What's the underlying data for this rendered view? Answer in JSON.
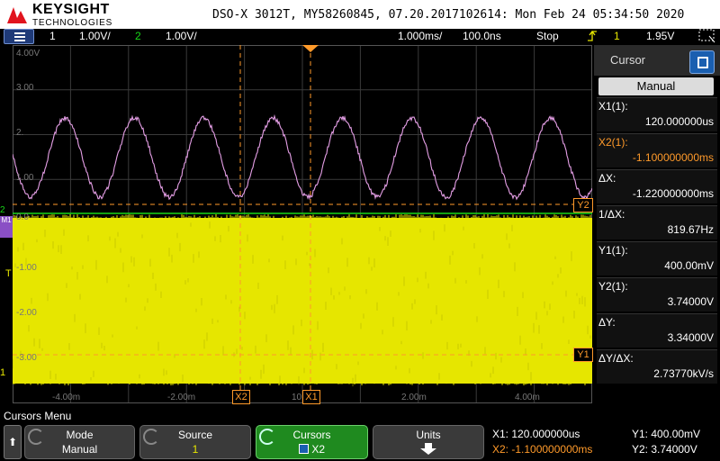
{
  "header": {
    "brand_line1": "KEYSIGHT",
    "brand_line2": "TECHNOLOGIES",
    "title": "DSO-X 3012T, MY58260845, 07.20.2017102614: Mon Feb 24 05:34:50 2020"
  },
  "status_bar": {
    "ch1_num": "1",
    "ch1_scale": "1.00V/",
    "ch2_num": "2",
    "ch2_scale": "1.00V/",
    "timebase": "1.000ms/",
    "delay": "100.0ns",
    "run_state": "Stop",
    "trigger_icon": "trigger-edge-icon",
    "trigger_source": "1",
    "trigger_level": "1.95V"
  },
  "graticule": {
    "y_labels": [
      "4.00V",
      "3.00",
      "2.",
      "1.00",
      "0.0",
      "-1.00",
      "-2.00",
      "-3.00"
    ],
    "x_labels": [
      "-4.00m",
      "-2.00m",
      "10",
      "2.00m",
      "4.00m"
    ],
    "cursor_tags": {
      "x1": "X1",
      "x2": "X2",
      "y1": "Y1",
      "y2": "Y2"
    },
    "markers": {
      "ch2": "2",
      "ch1": "M1",
      "trig": "T",
      "ground": "1"
    }
  },
  "cursor_panel": {
    "title": "Cursor",
    "mode_button": "Manual",
    "rows": [
      {
        "key": "X1(1):",
        "value": "120.000000us"
      },
      {
        "key": "X2(1):",
        "value": "-1.100000000ms"
      },
      {
        "key": "ΔX:",
        "value": "-1.220000000ms"
      },
      {
        "key": "1/ΔX:",
        "value": "819.67Hz"
      },
      {
        "key": "Y1(1):",
        "value": "400.00mV"
      },
      {
        "key": "Y2(1):",
        "value": "3.74000V"
      },
      {
        "key": "ΔY:",
        "value": "3.34000V"
      },
      {
        "key": "ΔY/ΔX:",
        "value": "2.73770kV/s"
      }
    ]
  },
  "softkeys": {
    "menu_label": "Cursors Menu",
    "back_icon": "up-arrow-icon",
    "mode_label": "Mode",
    "mode_value": "Manual",
    "source_label": "Source",
    "source_value": "1",
    "cursors_label": "Cursors",
    "cursors_value": "X2",
    "units_label": "Units",
    "units_icon": "down-arrow-icon"
  },
  "readout": {
    "x1": "X1: 120.000000us",
    "x2": "X2: -1.100000000ms",
    "y1": "Y1: 400.00mV",
    "y2": "Y2: 3.74000V"
  },
  "colors": {
    "ch1": "#e6e600",
    "ch2": "#e59fe6",
    "cursor": "#ff9a2a",
    "ground": "#18d818"
  }
}
